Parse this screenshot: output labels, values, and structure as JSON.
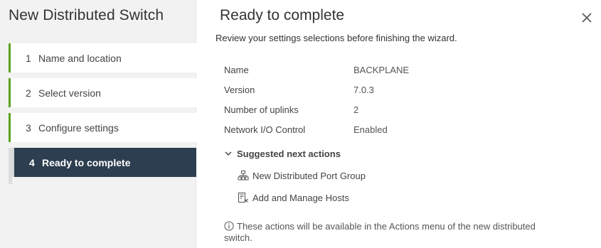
{
  "wizard": {
    "title": "New Distributed Switch",
    "steps": [
      {
        "num": "1",
        "label": "Name and location"
      },
      {
        "num": "2",
        "label": "Select version"
      },
      {
        "num": "3",
        "label": "Configure settings"
      },
      {
        "num": "4",
        "label": "Ready to complete"
      }
    ]
  },
  "main": {
    "title": "Ready to complete",
    "subtitle": "Review your settings selections before finishing the wizard.",
    "summary": [
      {
        "key": "Name",
        "value": "BACKPLANE"
      },
      {
        "key": "Version",
        "value": "7.0.3"
      },
      {
        "key": "Number of uplinks",
        "value": "2"
      },
      {
        "key": "Network I/O Control",
        "value": "Enabled"
      }
    ],
    "next_actions": {
      "header": "Suggested next actions",
      "items": [
        {
          "label": "New Distributed Port Group",
          "icon": "port-group-icon"
        },
        {
          "label": "Add and Manage Hosts",
          "icon": "hosts-icon"
        }
      ]
    },
    "note": "These actions will be available in the Actions menu of the new distributed switch."
  },
  "colors": {
    "active_step_bg": "#2c3e50",
    "complete_step_bar": "#5aa220"
  }
}
